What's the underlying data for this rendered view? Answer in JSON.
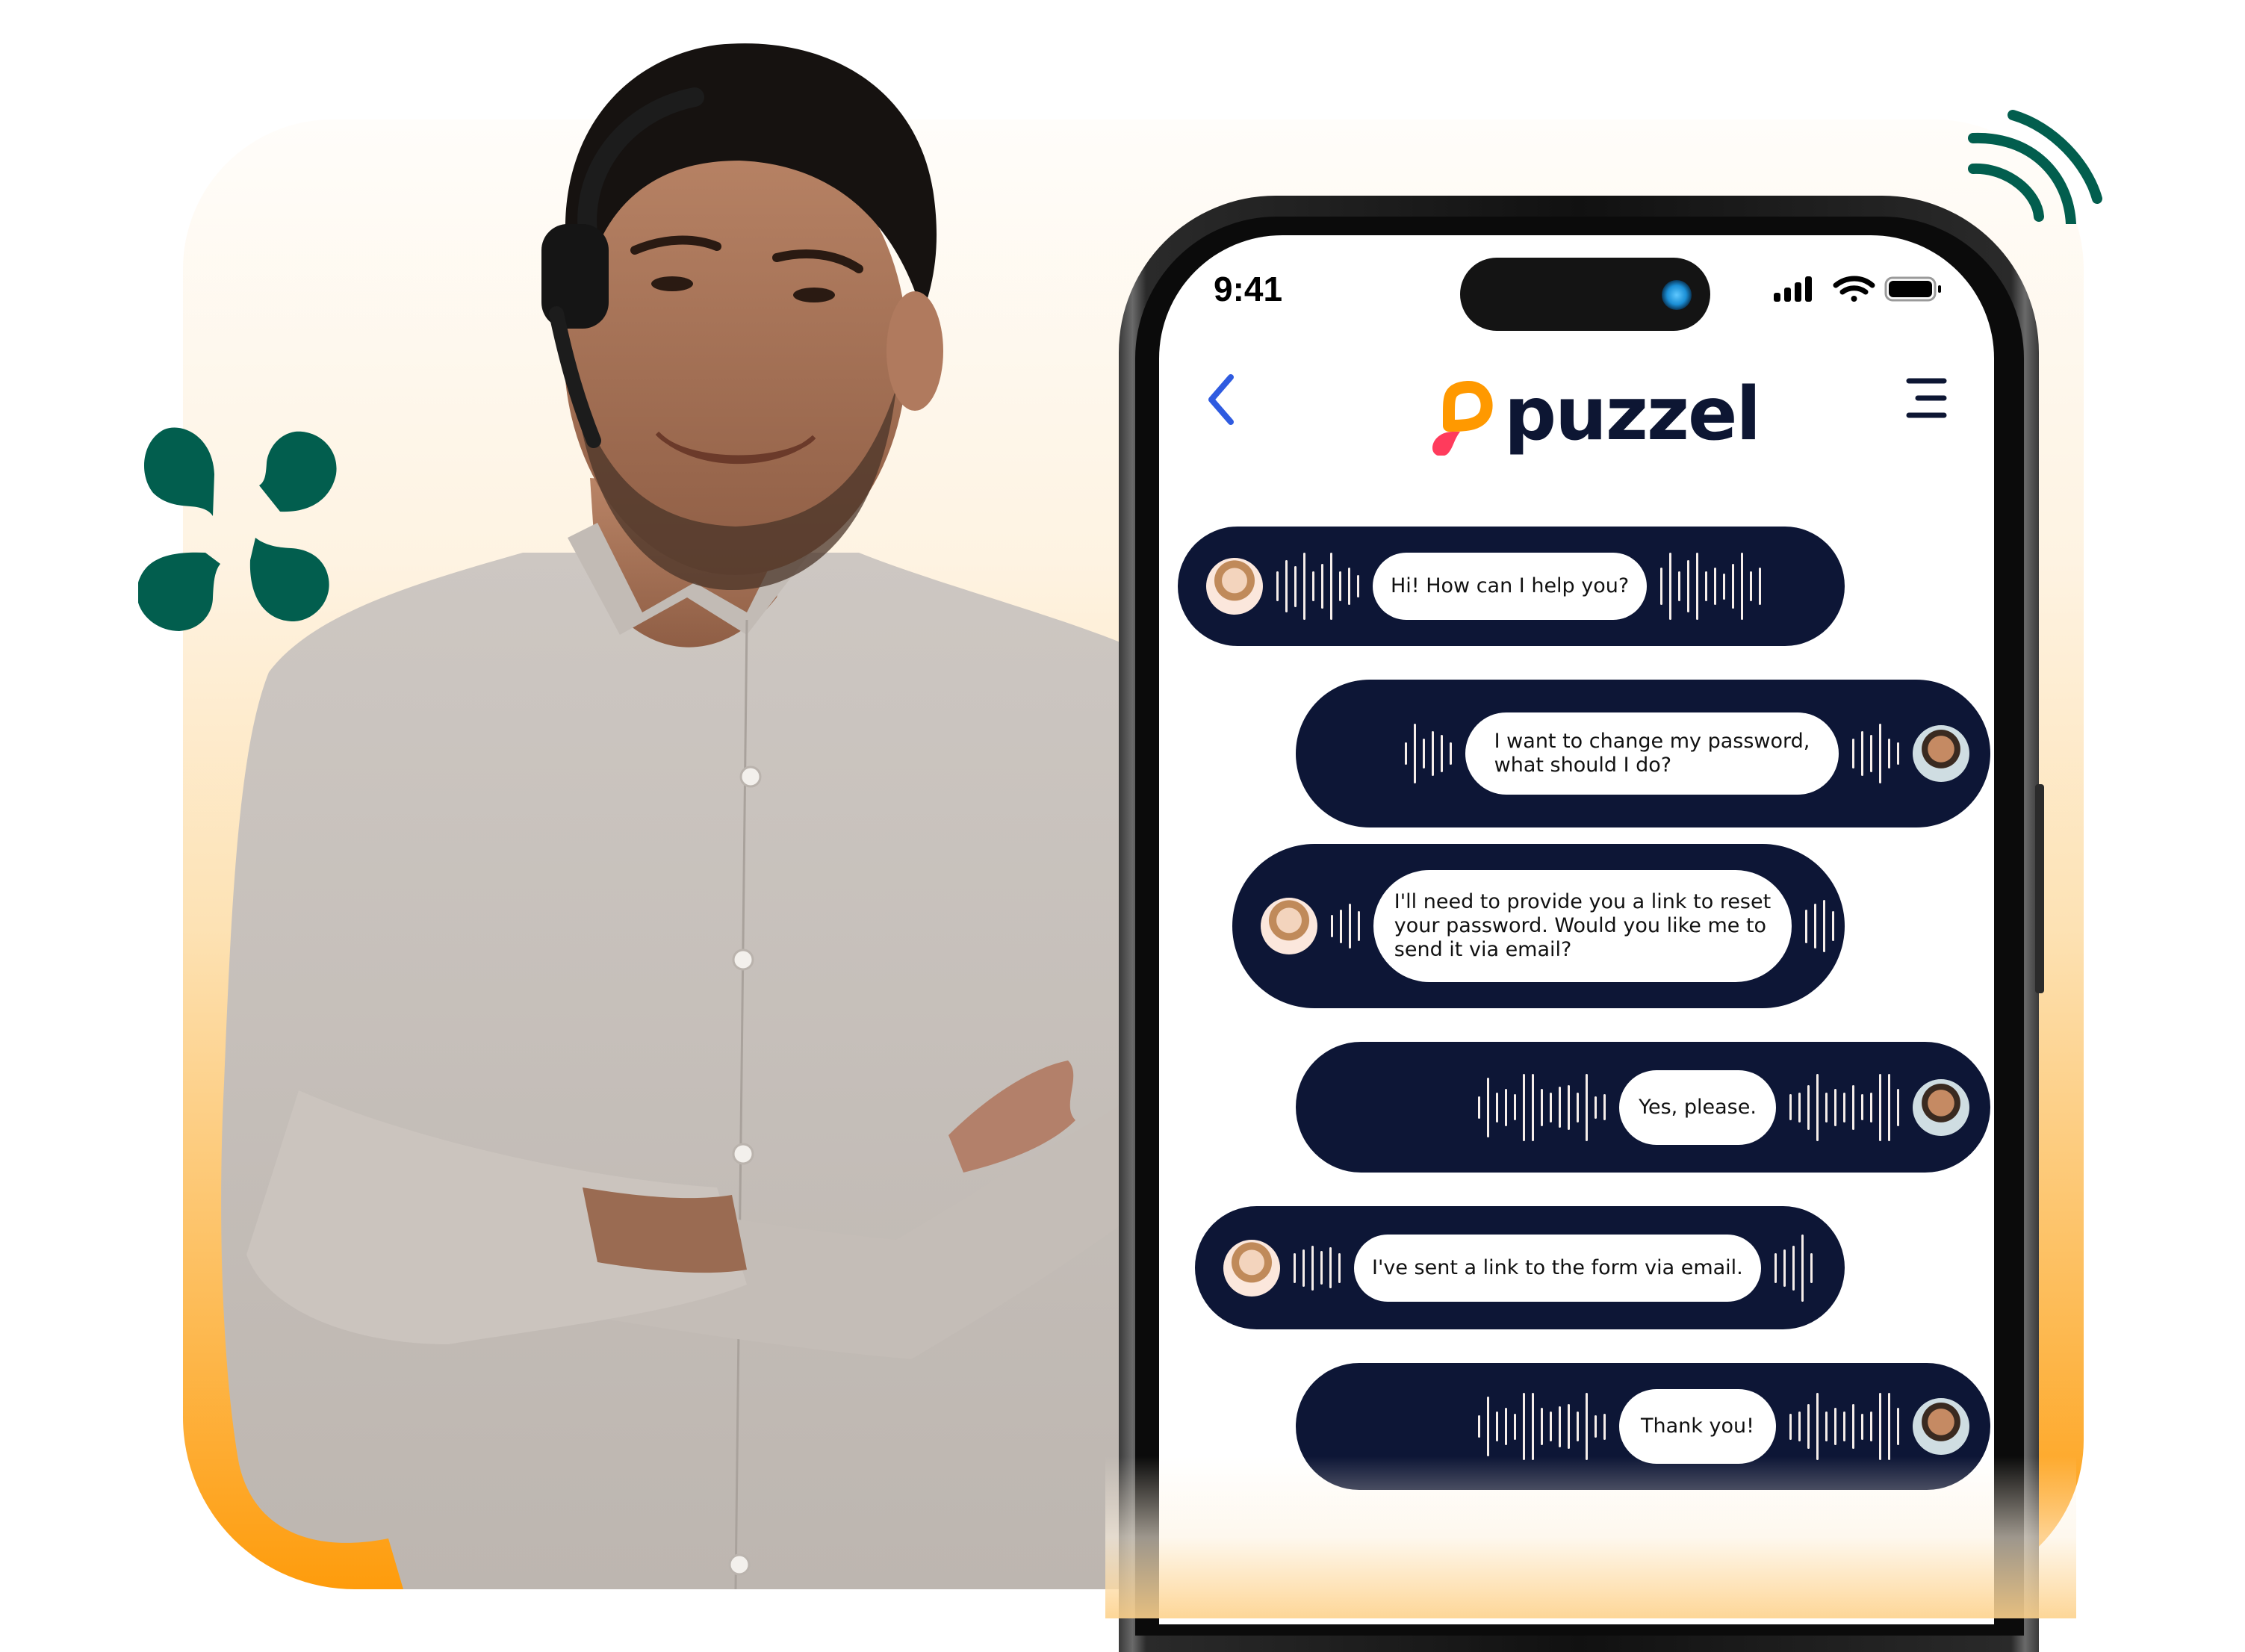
{
  "colors": {
    "background_top": "#fffdfa",
    "background_bottom": "#fe9c0c",
    "accent_green": "#025e4e",
    "bubble_navy": "#0d1636",
    "back_arrow_blue": "#2f5be0",
    "logo_orange": "#ff9900",
    "logo_red": "#ff3b5c"
  },
  "phone": {
    "status_bar": {
      "time": "9:41",
      "icons": [
        "cellular-signal-icon",
        "wifi-icon",
        "battery-icon"
      ]
    },
    "header": {
      "back_icon": "chevron-left-icon",
      "logo_text": "puzzel",
      "menu_icon": "hamburger-menu-icon"
    },
    "messages": [
      {
        "sender": "agent",
        "text": "Hi! How can I help you?"
      },
      {
        "sender": "customer",
        "text": "I want to change my password,\nwhat should I do?"
      },
      {
        "sender": "agent",
        "text": "I'll need to provide you a link to reset\nyour password. Would you like me to\nsend it via email?"
      },
      {
        "sender": "customer",
        "text": "Yes, please."
      },
      {
        "sender": "agent",
        "text": "I've sent a link to the form via email."
      },
      {
        "sender": "customer",
        "text": "Thank you!"
      }
    ]
  },
  "decorations": {
    "left_ornament": "four-petal-clover-icon",
    "top_right_ornament": "signal-waves-icon",
    "person": "smiling-agent-with-headset"
  }
}
